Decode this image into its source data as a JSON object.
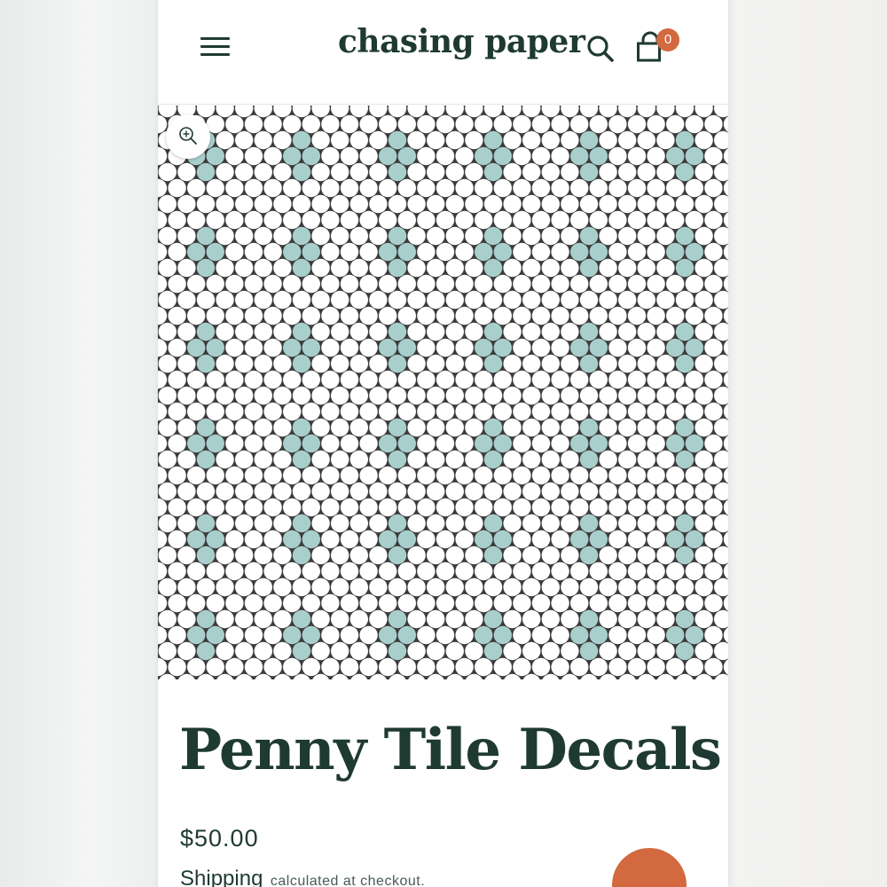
{
  "header": {
    "logo": "chasing paper",
    "menu_icon": "hamburger-menu-icon",
    "search_icon": "search-icon",
    "cart_icon": "shopping-bag-icon",
    "cart_count": "0"
  },
  "product": {
    "image_alt": "Penny tile pattern with white, light teal and red circular tiles forming hexagonal flower motifs",
    "zoom_icon": "zoom-in-icon",
    "title": "Penny Tile Decals",
    "price": "$50.00",
    "shipping_link": "Shipping",
    "shipping_text": "calculated at checkout."
  },
  "chat": {
    "icon": "chat-bubble-icon"
  },
  "colors": {
    "brand_dark_green": "#1e3a32",
    "accent_orange": "#d2693f",
    "tile_white": "#ffffff",
    "tile_teal": "#a9cfcd",
    "tile_red": "#b95a52",
    "grout": "#3b3b3b"
  }
}
